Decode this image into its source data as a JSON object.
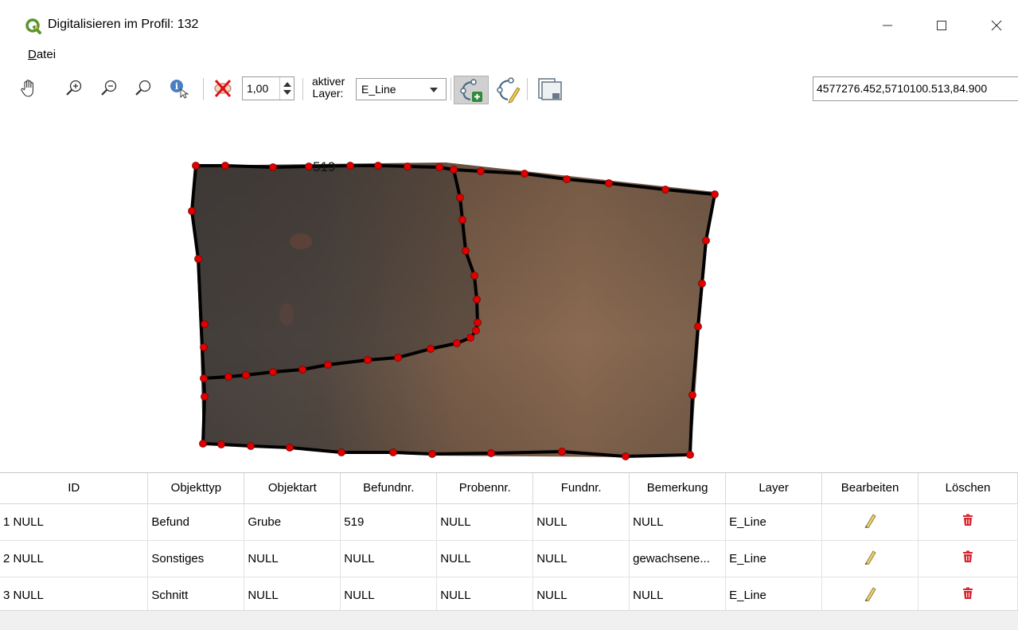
{
  "window": {
    "title": "Digitalisieren im Profil: 132",
    "icon": "qgis-logo",
    "controls": [
      "minimize-icon",
      "maximize-icon",
      "close-icon"
    ]
  },
  "menu": {
    "datei": "Datei"
  },
  "toolbar": {
    "icons": [
      "pan-hand-icon",
      "zoom-in-icon",
      "zoom-out-icon",
      "zoom-full-icon",
      "identify-icon",
      "visibility-off-icon",
      "add-feature-icon",
      "vertex-edit-icon",
      "save-edits-icon"
    ],
    "transparency_value": "1,00",
    "layer_label": "aktiver Layer:",
    "layer_selected": "E_Line",
    "coordinates": "4577276.452,5710100.513,84.900"
  },
  "canvas": {
    "feature_label": "519",
    "colors": {
      "line": "#000000",
      "vertex": "#e00000"
    }
  },
  "table": {
    "columns": [
      "ID",
      "Objekttyp",
      "Objektart",
      "Befundnr.",
      "Probennr.",
      "Fundnr.",
      "Bemerkung",
      "Layer",
      "Bearbeiten",
      "Löschen"
    ],
    "rows": [
      {
        "num": "1",
        "id": "NULL",
        "objekttyp": "Befund",
        "objektart": "Grube",
        "befundnr": "519",
        "probennr": "NULL",
        "fundnr": "NULL",
        "bemerkung": "NULL",
        "layer": "E_Line"
      },
      {
        "num": "2",
        "id": "NULL",
        "objekttyp": "Sonstiges",
        "objektart": "NULL",
        "befundnr": "NULL",
        "probennr": "NULL",
        "fundnr": "NULL",
        "bemerkung": "gewachsene...",
        "layer": "E_Line"
      },
      {
        "num": "3",
        "id": "NULL",
        "objekttyp": "Schnitt",
        "objektart": "NULL",
        "befundnr": "NULL",
        "probennr": "NULL",
        "fundnr": "NULL",
        "bemerkung": "NULL",
        "layer": "E_Line"
      }
    ],
    "edit_icon": "pencil-icon",
    "delete_icon": "trash-icon",
    "delete_color": "#d9232d"
  }
}
